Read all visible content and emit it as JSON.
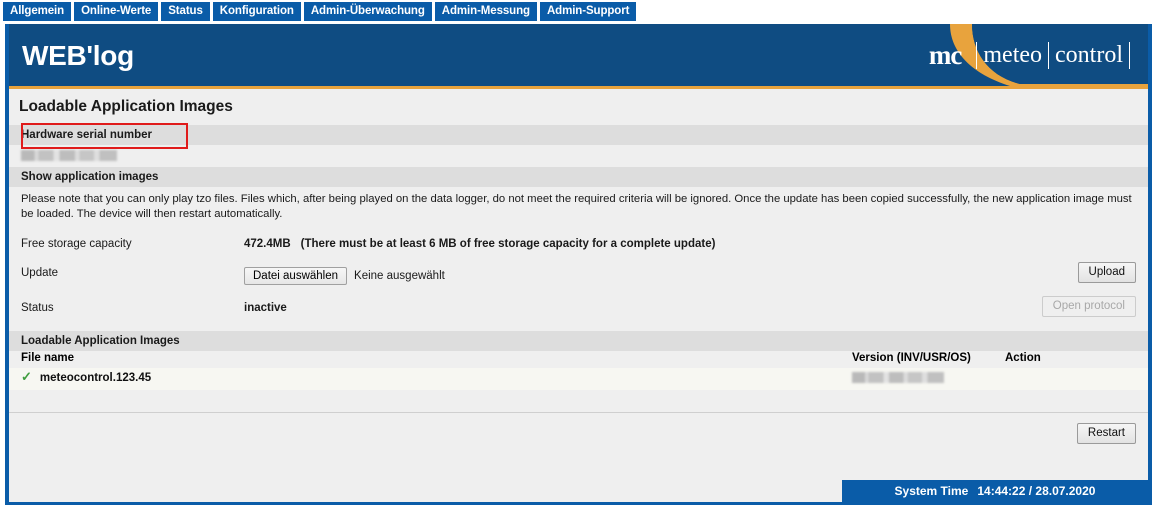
{
  "nav": {
    "tabs": [
      {
        "label": "Allgemein"
      },
      {
        "label": "Online-Werte"
      },
      {
        "label": "Status"
      },
      {
        "label": "Konfiguration"
      },
      {
        "label": "Admin-Überwachung"
      },
      {
        "label": "Admin-Messung"
      },
      {
        "label": "Admin-Support"
      }
    ]
  },
  "banner": {
    "product_title": "WEB'log",
    "logo_mark": "mc",
    "logo_word1": "meteo",
    "logo_word2": "control"
  },
  "page": {
    "heading": "Loadable Application Images"
  },
  "serial": {
    "section_label": "Hardware serial number",
    "value": ""
  },
  "show_images": {
    "section_label": "Show application images",
    "description": "Please note that you can only play tzo files. Files which, after being played on the data logger, do not meet the required criteria will be ignored. Once the update has been copied successfully, the new application image must be loaded. The device will then restart automatically."
  },
  "storage": {
    "label": "Free storage capacity",
    "value": "472.4MB",
    "note": "(There must be at least 6 MB of free storage capacity for a complete update)"
  },
  "update": {
    "label": "Update",
    "file_button": "Datei auswählen",
    "file_status": "Keine ausgewählt",
    "upload_button": "Upload"
  },
  "status": {
    "label": "Status",
    "value": "inactive",
    "protocol_button": "Open protocol"
  },
  "images_table": {
    "section_label": "Loadable Application Images",
    "columns": {
      "file_name": "File name",
      "version": "Version (INV/USR/OS)",
      "action": "Action"
    },
    "rows": [
      {
        "file_name": "meteocontrol.123.45",
        "version": "",
        "action": ""
      }
    ],
    "restart_button": "Restart"
  },
  "footer": {
    "label": "System Time",
    "value": "14:44:22 / 28.07.2020"
  },
  "colors": {
    "nav_blue": "#0a5ca8",
    "banner_blue": "#0f4c82",
    "accent_orange": "#e8a33d",
    "highlight_red": "#e01b1b",
    "check_green": "#3f9d3f"
  }
}
